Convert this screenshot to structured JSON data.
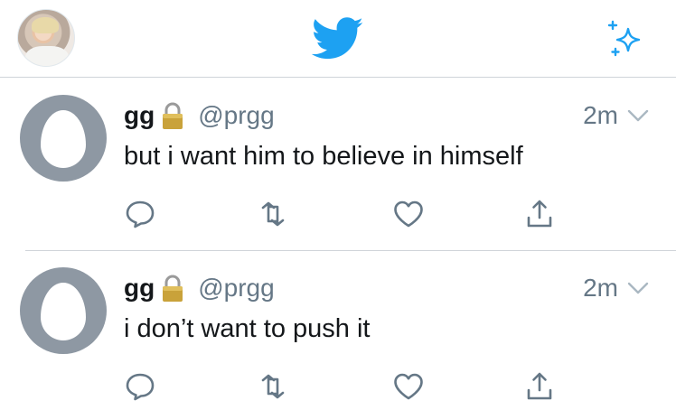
{
  "header": {
    "profile_avatar": "user-profile-photo",
    "logo_icon": "twitter-bird-icon",
    "compose_icon": "sparkle-icon"
  },
  "tweets": [
    {
      "name": "gg",
      "handle": "@prgg",
      "time": "2m",
      "text": "but i want him to believe in himself",
      "avatar": "default-egg-avatar"
    },
    {
      "name": "gg",
      "handle": "@prgg",
      "time": "2m",
      "text": "i don’t want to push it",
      "avatar": "default-egg-avatar"
    }
  ],
  "colors": {
    "twitter_blue": "#1DA1F2",
    "secondary_text": "#657786",
    "primary_text": "#14171A",
    "divider": "#CFD4D9",
    "egg_gray": "#8E98A3",
    "icon_gray": "#657786"
  },
  "icons": {
    "lock": "lock-icon",
    "chevron": "chevron-down-icon",
    "reply": "reply-icon",
    "retweet": "retweet-icon",
    "like": "heart-icon",
    "share": "share-icon"
  }
}
